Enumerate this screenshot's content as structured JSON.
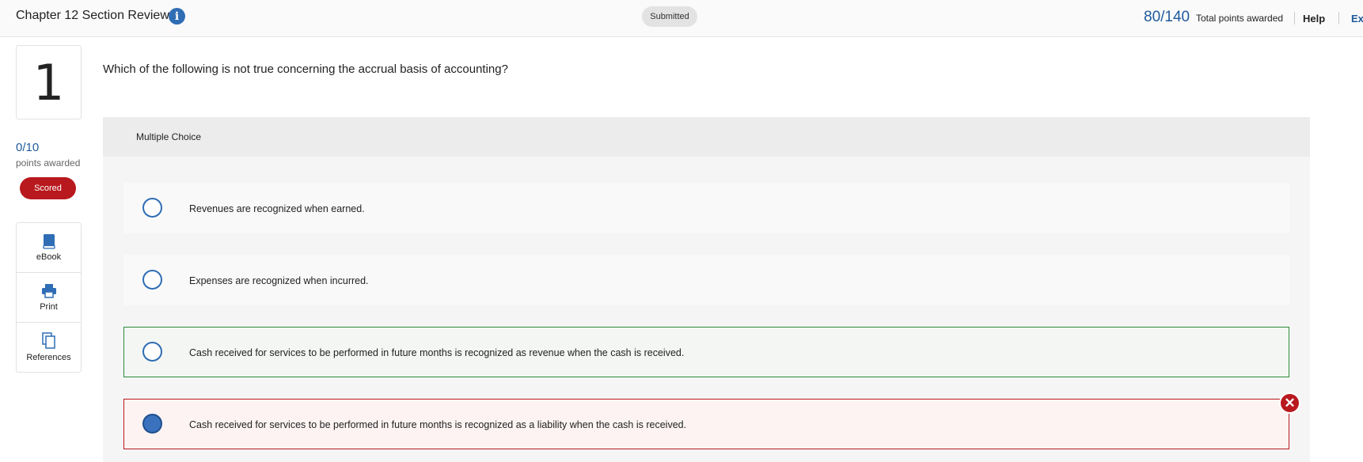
{
  "header": {
    "title": "Chapter 12 Section Review",
    "status": "Submitted",
    "total_points": "80/140",
    "total_points_label": "Total points awarded",
    "help": "Help",
    "exit": "Exit"
  },
  "question": {
    "number": "1",
    "score": "0/10",
    "points_label": "points awarded",
    "badge": "Scored",
    "text": "Which of the following is not true concerning the accrual basis of accounting?",
    "type_label": "Multiple Choice",
    "options": [
      {
        "text": "Revenues are recognized when earned.",
        "state": "neutral",
        "selected": false
      },
      {
        "text": "Expenses are recognized when incurred.",
        "state": "neutral",
        "selected": false
      },
      {
        "text": "Cash received for services to be performed in future months is recognized as revenue when the cash is received.",
        "state": "correct",
        "selected": false
      },
      {
        "text": "Cash received for services to be performed in future months is recognized as a liability when the cash is received.",
        "state": "incorrect",
        "selected": true
      }
    ]
  },
  "tools": [
    {
      "label": "eBook",
      "icon": "book-icon"
    },
    {
      "label": "Print",
      "icon": "printer-icon"
    },
    {
      "label": "References",
      "icon": "documents-icon"
    }
  ],
  "colors": {
    "accent": "#2f6db5",
    "scored_badge": "#b8191e",
    "correct_border": "#2e8b3a",
    "incorrect_border": "#b8191e"
  }
}
